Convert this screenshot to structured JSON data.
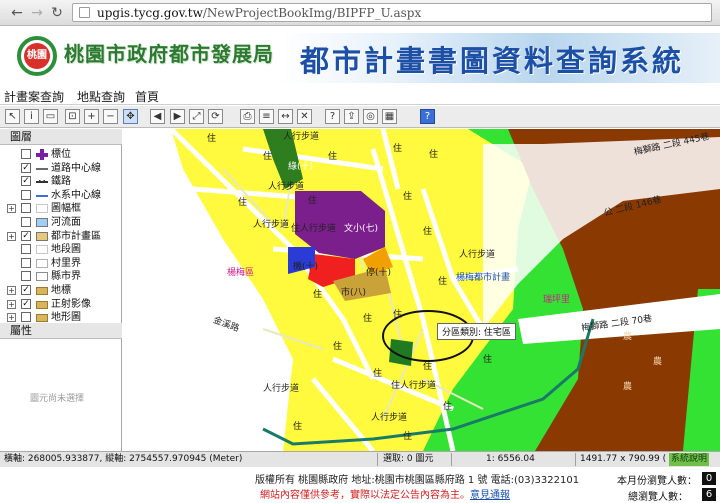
{
  "browser": {
    "url_host": "upgis.tycg.gov.tw",
    "url_path": "/NewProjectBookImg/BIPFP_U.aspx"
  },
  "banner": {
    "logo_text": "桃園",
    "agency": "桃園市政府都市發展局",
    "system_title": "都市計畫書圖資料查詢系統"
  },
  "menu": {
    "items": [
      "計畫案查詢",
      "地點查詢",
      "首頁"
    ]
  },
  "toolbar": {
    "tools": [
      "select-tool",
      "identify-tool",
      "zoom-box-tool",
      "zoom-in-tool",
      "zoom-out-tool",
      "pan-tool",
      "zoom-previous-tool",
      "zoom-next-tool",
      "full-extent-tool",
      "refresh-tool",
      "print-tool",
      "layer-list-tool",
      "measure-tool",
      "clear-tool",
      "query-tool",
      "export-tool",
      "buffer-tool",
      "table-tool",
      "help-tool"
    ]
  },
  "layers_panel": {
    "title": "圖層",
    "layers": [
      {
        "label": "標位",
        "checked": false,
        "expander": "",
        "symbol": "cross",
        "color": "#7a1fa2"
      },
      {
        "label": "道路中心線",
        "checked": true,
        "expander": "",
        "symbol": "line",
        "color": "#6a6a6a"
      },
      {
        "label": "鐵路",
        "checked": true,
        "expander": "",
        "symbol": "rail",
        "color": "#333333"
      },
      {
        "label": "水系中心線",
        "checked": false,
        "expander": "",
        "symbol": "line",
        "color": "#3a6fd8"
      },
      {
        "label": "圖幅框",
        "checked": false,
        "expander": "+",
        "symbol": "box",
        "color": "#c7c7c7"
      },
      {
        "label": "河流面",
        "checked": false,
        "expander": "",
        "symbol": "fill",
        "color": "#9fd0f3"
      },
      {
        "label": "都市計畫區",
        "checked": true,
        "expander": "+",
        "symbol": "fill",
        "color": "#e6c87a"
      },
      {
        "label": "地段圖",
        "checked": false,
        "expander": "",
        "symbol": "box",
        "color": "#c7c7c7"
      },
      {
        "label": "村里界",
        "checked": false,
        "expander": "",
        "symbol": "box",
        "color": "#b0b0b0"
      },
      {
        "label": "縣市界",
        "checked": false,
        "expander": "",
        "symbol": "box",
        "color": "#8c8c8c"
      },
      {
        "label": "地標",
        "checked": true,
        "expander": "+",
        "symbol": "folder",
        "color": "#d8b45a"
      },
      {
        "label": "正射影像",
        "checked": true,
        "expander": "+",
        "symbol": "folder",
        "color": "#d8b45a"
      },
      {
        "label": "地形圖",
        "checked": false,
        "expander": "+",
        "symbol": "folder",
        "color": "#d8b45a"
      }
    ],
    "properties_title": "屬性",
    "properties_empty": "圖元尚未選擇"
  },
  "map": {
    "labels": {
      "walkway_1": "人行步道",
      "walkway_2": "人行步道",
      "walkway_3": "人行步道",
      "walkway_4": "人行步道",
      "walkway_5": "人行步道",
      "walkway_6": "人行步道",
      "walkway_7": "住人行步道",
      "walkway_8": "住人行步道",
      "cultural": "文小(七)",
      "market": "市(八)",
      "park": "停(十)",
      "school_small": "機(十)",
      "boundary": "楊梅都市計畫",
      "road_1": "梅獅路 二段 445巷",
      "road_2": "梅獅路 二段 70巷",
      "road_3": "公 二段 146巷",
      "road_4": "梅獅路 二段",
      "road_5": "金溪路",
      "neighbor": "楊梅區",
      "green": "綠(十)",
      "district": "金溪里",
      "village": "瑞坪里"
    },
    "tooltip": "分區類別: 住宅區",
    "residential_marker": "住",
    "agri_marker": "農",
    "park_marker": "公園"
  },
  "status": {
    "coords": "橫軸: 268005.933877, 縱軸: 2754557.970945 (Meter)",
    "select_count": "選取: 0 圖元",
    "scale": "1: 6556.04",
    "extent": "1491.77 x 790.99 (公",
    "system_button": "系統說明"
  },
  "footer": {
    "copyright": "版權所有 桃園縣政府 地址:桃園市桃園區縣府路 1 號 電話:(03)3322101",
    "notice": "網站內容僅供參考，實際以法定公告內容為主。",
    "notice_link": "意見通報",
    "monthly_label": "本月份瀏覽人數：",
    "total_label": "總瀏覽人數：",
    "monthly_count": "0",
    "total_count": "6"
  }
}
